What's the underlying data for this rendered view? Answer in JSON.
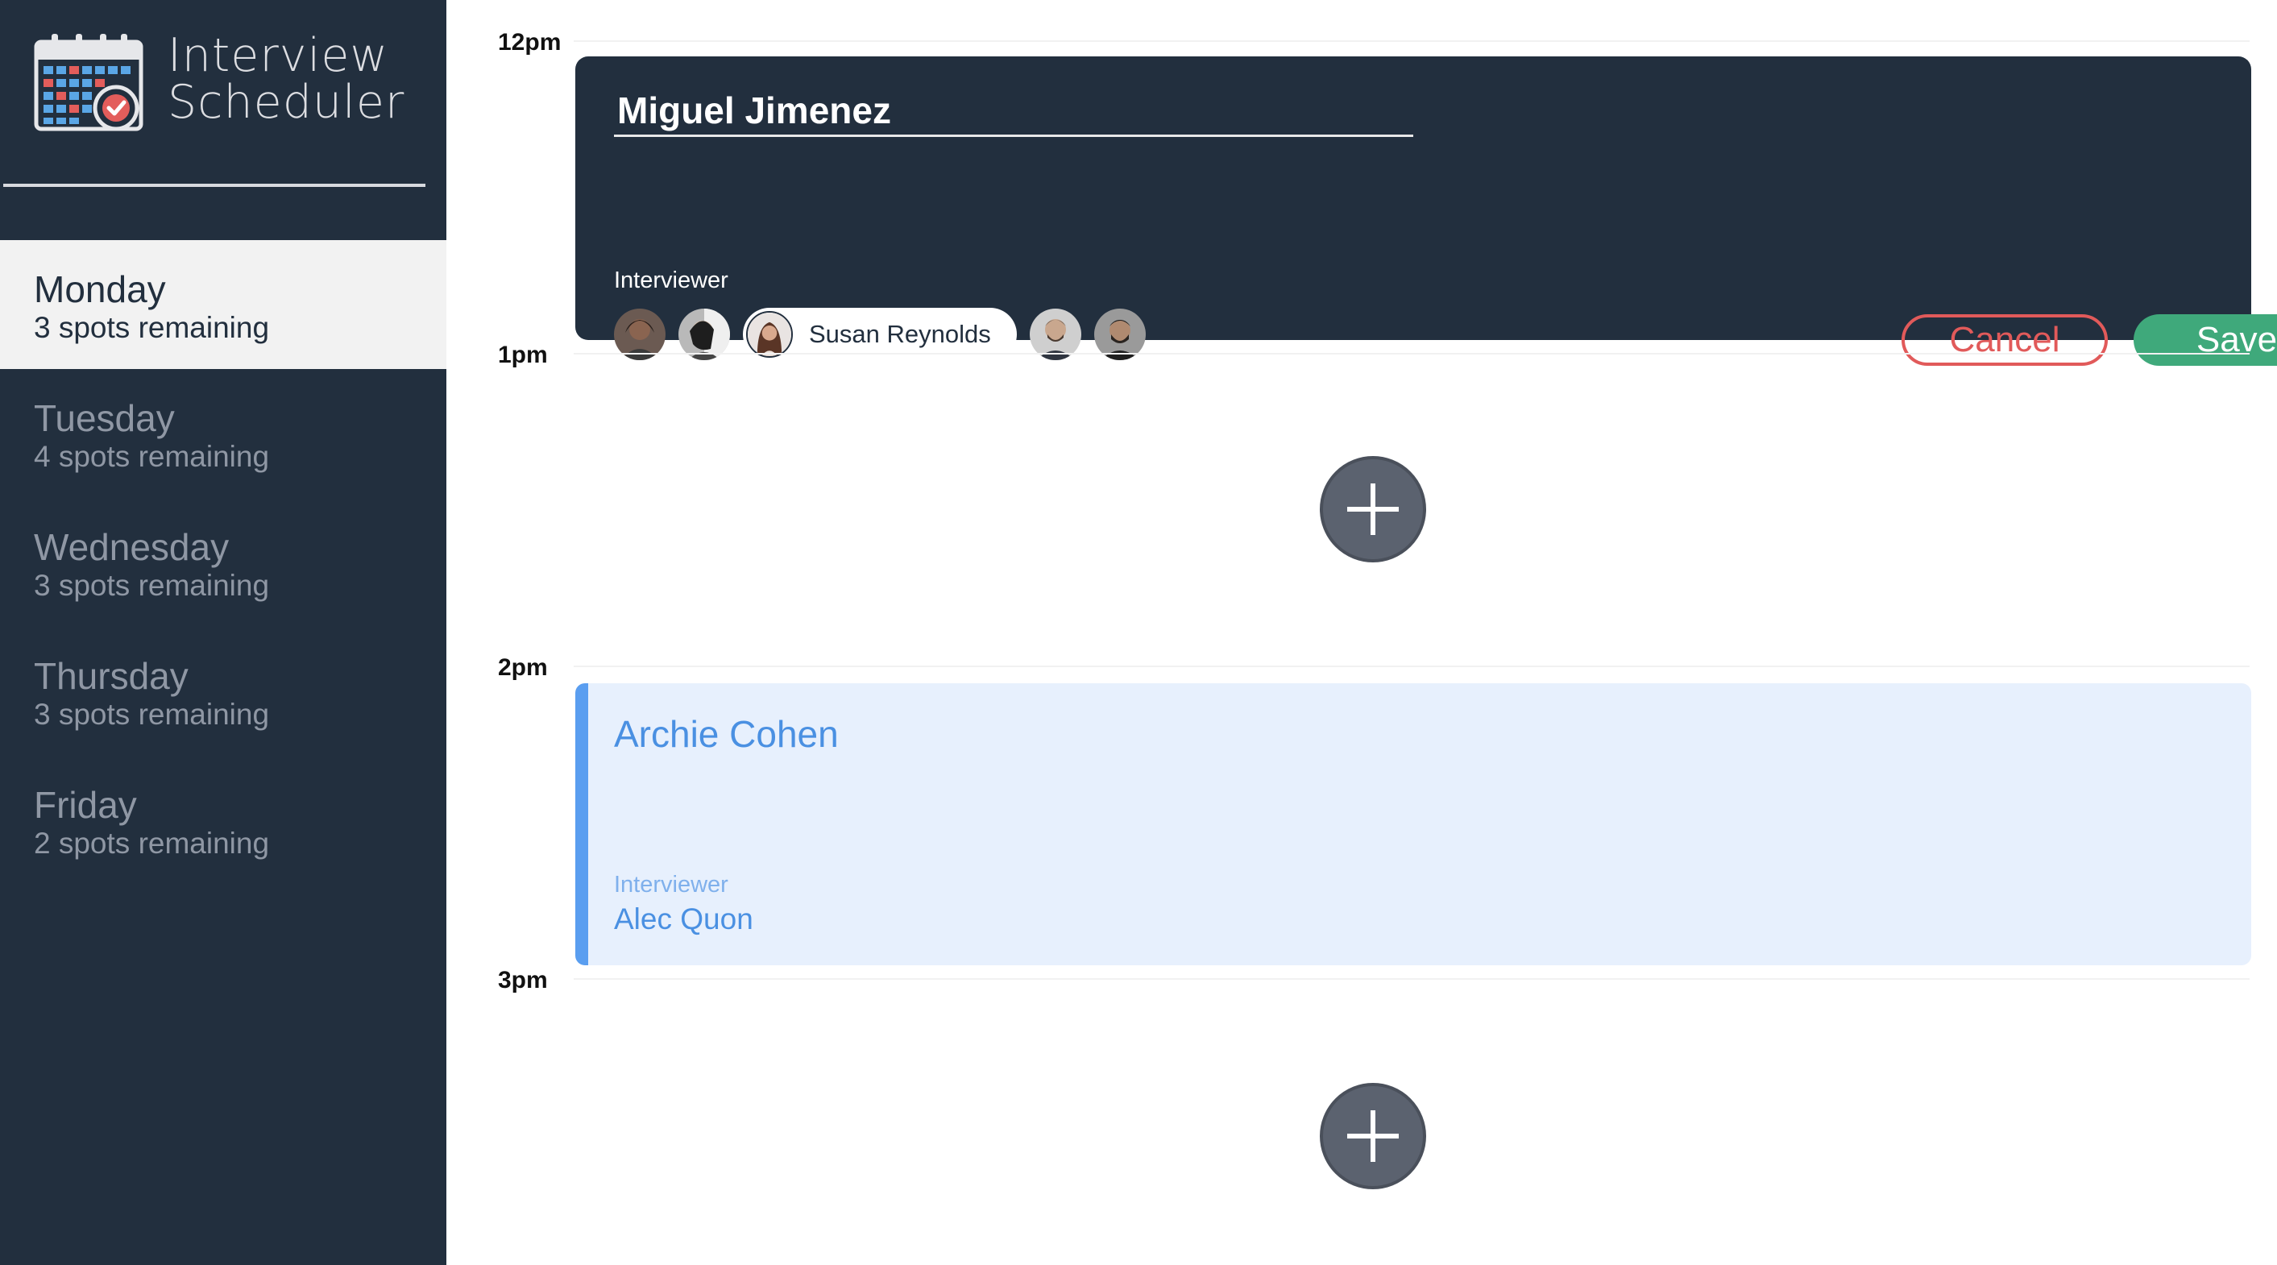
{
  "app": {
    "title_line1": "Interview",
    "title_line2": "Scheduler"
  },
  "sidebar": {
    "days": [
      {
        "name": "Monday",
        "spots": "3 spots remaining",
        "selected": true
      },
      {
        "name": "Tuesday",
        "spots": "4 spots remaining",
        "selected": false
      },
      {
        "name": "Wednesday",
        "spots": "3 spots remaining",
        "selected": false
      },
      {
        "name": "Thursday",
        "spots": "3 spots remaining",
        "selected": false
      },
      {
        "name": "Friday",
        "spots": "2 spots remaining",
        "selected": false
      }
    ]
  },
  "schedule": {
    "hours": [
      "12pm",
      "1pm",
      "2pm",
      "3pm"
    ]
  },
  "edit_form": {
    "student_name": "Miguel Jimenez",
    "interviewer_label": "Interviewer",
    "selected_interviewer": "Susan Reynolds",
    "cancel_label": "Cancel",
    "save_label": "Save"
  },
  "booked": {
    "student": "Archie Cohen",
    "interviewer_label": "Interviewer",
    "interviewer": "Alec Quon"
  },
  "colors": {
    "sidebar_bg": "#222f3e",
    "cancel": "#e15a5a",
    "save": "#3fa97b",
    "booked_accent": "#5a9ef0",
    "booked_bg": "#e7f0fd"
  },
  "icons": {
    "logo": "calendar-check-icon",
    "add": "plus-icon"
  }
}
